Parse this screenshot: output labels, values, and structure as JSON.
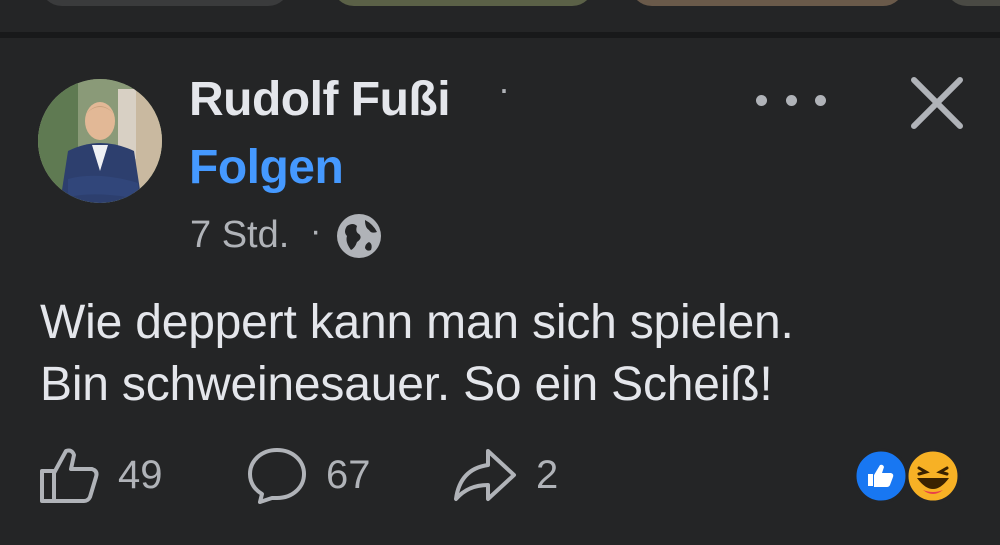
{
  "post": {
    "author": "Rudolf Fußi",
    "author_separator": "·",
    "follow_label": "Folgen",
    "time": "7 Std.",
    "meta_separator": "·",
    "privacy_icon": "globe-icon",
    "text_line1": "Wie deppert kann man sich spielen.",
    "text_line2": "Bin schweinesauer. So ein Scheiß!"
  },
  "actions": {
    "like_count": "49",
    "comment_count": "67",
    "share_count": "2"
  },
  "reactions": [
    "like",
    "haha"
  ],
  "icons": {
    "more": "more-icon",
    "close": "close-icon",
    "like": "thumbs-up-icon",
    "comment": "comment-icon",
    "share": "share-icon"
  },
  "colors": {
    "background": "#242526",
    "accent": "#4599ff",
    "text": "#e4e6eb",
    "muted": "#b0b3b8"
  }
}
